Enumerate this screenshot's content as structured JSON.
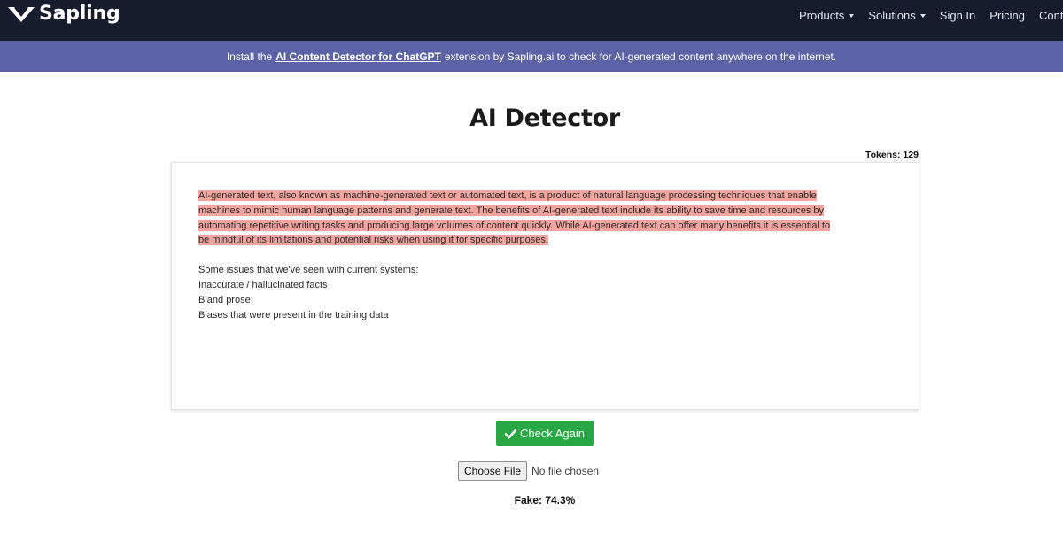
{
  "navbar": {
    "brand": "Sapling",
    "links": [
      {
        "label": "Products",
        "dropdown": true
      },
      {
        "label": "Solutions",
        "dropdown": true
      },
      {
        "label": "Sign In",
        "dropdown": false
      },
      {
        "label": "Pricing",
        "dropdown": false
      },
      {
        "label": "Contact",
        "dropdown": false
      }
    ]
  },
  "banner": {
    "prefix": "Install the",
    "link": "AI Content Detector for ChatGPT",
    "suffix": "extension by Sapling.ai to check for AI-generated content anywhere on the internet."
  },
  "page": {
    "title": "AI Detector",
    "tokens_label": "Tokens:",
    "tokens_value": "129"
  },
  "editor": {
    "highlighted_lines": [
      "AI-generated text, also known as machine-generated text or automated text, is a product of natural language processing techniques that enable",
      "machines to mimic human language patterns and generate text. The benefits of AI-generated text include its ability to save time and resources by",
      "automating repetitive writing tasks and producing large volumes of content quickly. While AI-generated text can offer many benefits it is essential to",
      "be mindful of its limitations and potential risks when using it for specific purposes."
    ],
    "plain_lines": [
      "Some issues that we've seen with current systems:",
      "Inaccurate / hallucinated facts",
      "Bland prose",
      "Biases that were present in the training data"
    ],
    "highlight_color": "#f3a49e"
  },
  "actions": {
    "check_label": "Check Again",
    "file_button": "Choose File",
    "file_status": "No file chosen"
  },
  "result": {
    "text": "Fake: 74.3%"
  },
  "colors": {
    "navbar_bg": "#161b2e",
    "banner_bg": "#5b62a6",
    "check_button": "#28a745"
  }
}
